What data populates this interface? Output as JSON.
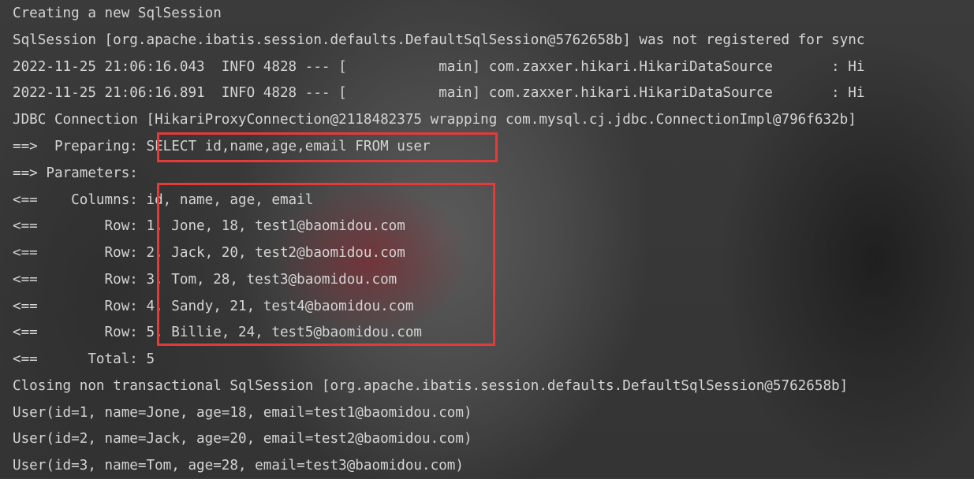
{
  "console": {
    "lines": [
      "Creating a new SqlSession",
      "SqlSession [org.apache.ibatis.session.defaults.DefaultSqlSession@5762658b] was not registered for sync",
      "2022-11-25 21:06:16.043  INFO 4828 --- [           main] com.zaxxer.hikari.HikariDataSource       : Hi",
      "2022-11-25 21:06:16.891  INFO 4828 --- [           main] com.zaxxer.hikari.HikariDataSource       : Hi",
      "JDBC Connection [HikariProxyConnection@2118482375 wrapping com.mysql.cj.jdbc.ConnectionImpl@796f632b]",
      "==>  Preparing: SELECT id,name,age,email FROM user",
      "==> Parameters: ",
      "<==    Columns: id, name, age, email",
      "<==        Row: 1, Jone, 18, test1@baomidou.com",
      "<==        Row: 2, Jack, 20, test2@baomidou.com",
      "<==        Row: 3, Tom, 28, test3@baomidou.com",
      "<==        Row: 4, Sandy, 21, test4@baomidou.com",
      "<==        Row: 5, Billie, 24, test5@baomidou.com",
      "<==      Total: 5",
      "Closing non transactional SqlSession [org.apache.ibatis.session.defaults.DefaultSqlSession@5762658b]",
      "User(id=1, name=Jone, age=18, email=test1@baomidou.com)",
      "User(id=2, name=Jack, age=20, email=test2@baomidou.com)",
      "User(id=3, name=Tom, age=28, email=test3@baomidou.com)"
    ]
  },
  "colors": {
    "text": "#d4d4d4",
    "highlight": "#e53a3a"
  }
}
